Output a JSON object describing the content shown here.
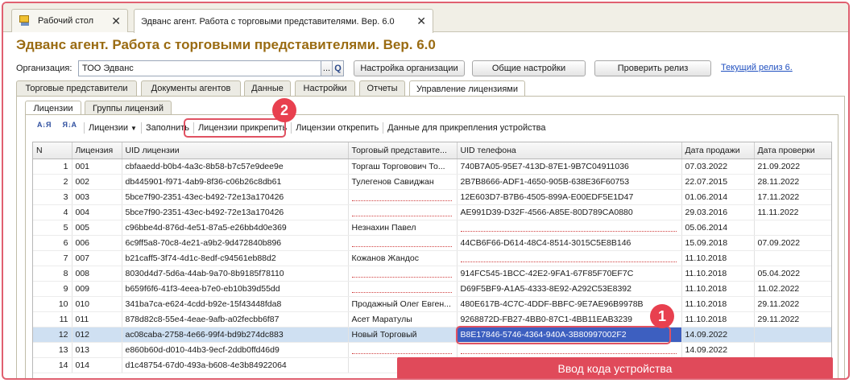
{
  "window_tabs": [
    {
      "label": "Рабочий стол",
      "close": "✕"
    },
    {
      "label": "Эдванс агент. Работа с торговыми представителями. Вер. 6.0",
      "close": "✕"
    }
  ],
  "title": "Эдванс агент. Работа с торговыми представителями. Вер. 6.0",
  "organization": {
    "label": "Организация:",
    "value": "ТОО Эдванс",
    "dots": "...",
    "search": "Q"
  },
  "buttons": {
    "org_settings": "Настройка организации",
    "general_settings": "Общие настройки",
    "check_release": "Проверить релиз",
    "current_release": "Текущий релиз 6."
  },
  "main_tabs": [
    "Торговые представители",
    "Документы агентов",
    "Данные",
    "Настройки",
    "Отчеты",
    "Управление лицензиями"
  ],
  "sub_tabs": [
    "Лицензии",
    "Группы лицензий"
  ],
  "toolbar": {
    "sort_asc": "А↓Я",
    "sort_desc": "Я↓А",
    "licenses_menu": "Лицензии",
    "fill": "Заполнить",
    "attach": "Лицензии прикрепить",
    "detach": "Лицензии открепить",
    "device_data": "Данные для прикрепления устройства"
  },
  "table": {
    "columns": [
      "N",
      "Лицензия",
      "UID лицензии",
      "Торговый представите...",
      "UID телефона",
      "Дата продажи",
      "Дата проверки"
    ],
    "rows": [
      {
        "n": "1",
        "lic": "001",
        "uid": "cbfaaedd-b0b4-4a3c-8b58-b7c57e9dee9e",
        "agent": "Торгаш Торговович То...",
        "phone": "740B7A05-95E7-413D-87E1-9B7C04911036",
        "sale": "07.03.2022",
        "check": "21.09.2022"
      },
      {
        "n": "2",
        "lic": "002",
        "uid": "db445901-f971-4ab9-8f36-c06b26c8db61",
        "agent": "Тулегенов Савиджан",
        "phone": "2B7B8666-ADF1-4650-905B-638E36F60753",
        "sale": "22.07.2015",
        "check": "28.11.2022"
      },
      {
        "n": "3",
        "lic": "003",
        "uid": "5bce7f90-2351-43ec-b492-72e13a170426",
        "agent": "",
        "phone": "12E603D7-B7B6-4505-899A-E00EDF5E1D47",
        "sale": "01.06.2014",
        "check": "17.11.2022"
      },
      {
        "n": "4",
        "lic": "004",
        "uid": "5bce7f90-2351-43ec-b492-72e13a170426",
        "agent": "",
        "phone": "AE991D39-D32F-4566-A85E-80D789CA0880",
        "sale": "29.03.2016",
        "check": "11.11.2022"
      },
      {
        "n": "5",
        "lic": "005",
        "uid": "c96bbe4d-876d-4e51-87a5-e26bb4d0e369",
        "agent": "Незнахин Павел",
        "phone": "",
        "sale": "05.06.2014",
        "check": ""
      },
      {
        "n": "6",
        "lic": "006",
        "uid": "6c9ff5a8-70c8-4e21-a9b2-9d472840b896",
        "agent": "",
        "phone": "44CB6F66-D614-48C4-8514-3015C5E8B146",
        "sale": "15.09.2018",
        "check": "07.09.2022"
      },
      {
        "n": "7",
        "lic": "007",
        "uid": "b21caff5-3f74-4d1c-8edf-c94561eb88d2",
        "agent": "Кожанов Жандос",
        "phone": "",
        "sale": "11.10.2018",
        "check": ""
      },
      {
        "n": "8",
        "lic": "008",
        "uid": "8030d4d7-5d6a-44ab-9a70-8b9185f78110",
        "agent": "",
        "phone": "914FC545-1BCC-42E2-9FA1-67F85F70EF7C",
        "sale": "11.10.2018",
        "check": "05.04.2022"
      },
      {
        "n": "9",
        "lic": "009",
        "uid": "b659f6f6-41f3-4eea-b7e0-eb10b39d55dd",
        "agent": "",
        "phone": "D69F5BF9-A1A5-4333-8E92-A292C53E8392",
        "sale": "11.10.2018",
        "check": "11.02.2022"
      },
      {
        "n": "10",
        "lic": "010",
        "uid": "341ba7ca-e624-4cdd-b92e-15f43448fda8",
        "agent": "Продажный Олег Евген...",
        "phone": "480E617B-4C7C-4DDF-BBFC-9E7AE96B9978B",
        "sale": "11.10.2018",
        "check": "29.11.2022"
      },
      {
        "n": "11",
        "lic": "011",
        "uid": "878d82c8-55e4-4eae-9afb-a02fecbb6f87",
        "agent": "Асет Маратулы",
        "phone": "9268872D-FB27-4BB0-87C1-4BB11EAB3239",
        "sale": "11.10.2018",
        "check": "29.11.2022"
      },
      {
        "n": "12",
        "lic": "012",
        "uid": "ac08caba-2758-4e66-99f4-bd9b274dc883",
        "agent": "Новый Торговый",
        "phone": "B8E17846-5746-4364-940A-3B80997002F2",
        "sale": "14.09.2022",
        "check": ""
      },
      {
        "n": "13",
        "lic": "013",
        "uid": "e860b60d-d010-44b3-9ecf-2ddb0ffd46d9",
        "agent": "",
        "phone": "",
        "sale": "14.09.2022",
        "check": ""
      },
      {
        "n": "14",
        "lic": "014",
        "uid": "d1c48754-67d0-493a-b608-4e3b84922064",
        "agent": "",
        "phone": "",
        "sale": "",
        "check": ""
      }
    ]
  },
  "annotations": {
    "badge1": "1",
    "badge2": "2",
    "callout": "Ввод кода устройства"
  },
  "colors": {
    "accent_red": "#e8404f",
    "title_gold": "#9a6b12",
    "selection": "#3d5fc0"
  }
}
